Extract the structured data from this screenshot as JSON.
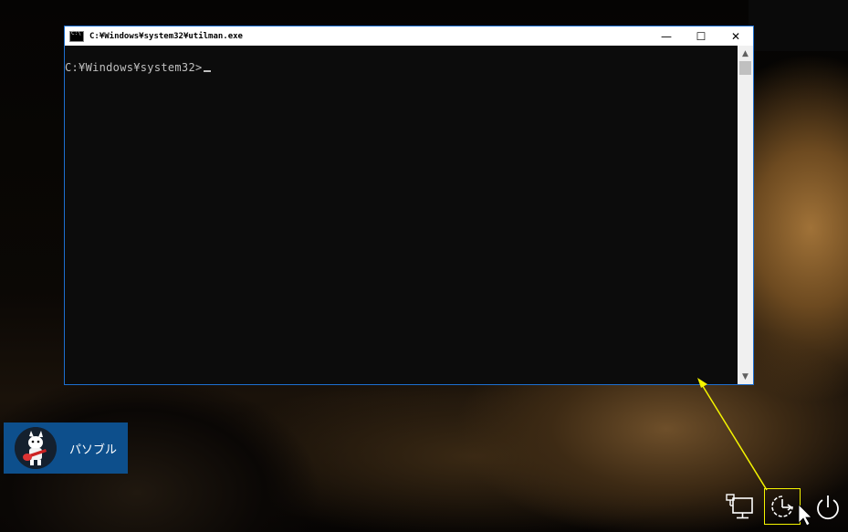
{
  "window": {
    "title": "C:¥Windows¥system32¥utilman.exe",
    "prompt": "C:¥Windows¥system32>",
    "minimize_glyph": "—",
    "maximize_glyph": "☐",
    "close_glyph": "✕",
    "icon": "console-icon"
  },
  "user_tile": {
    "name": "パソブル",
    "avatar_icon": "dog-avatar-icon"
  },
  "system_icons": [
    {
      "name": "network-icon"
    },
    {
      "name": "ease-of-access-icon"
    },
    {
      "name": "power-icon"
    }
  ],
  "colors": {
    "highlight": "#f5f500",
    "window_border": "#1d6fd0",
    "user_tile": "#0d4f8c"
  }
}
